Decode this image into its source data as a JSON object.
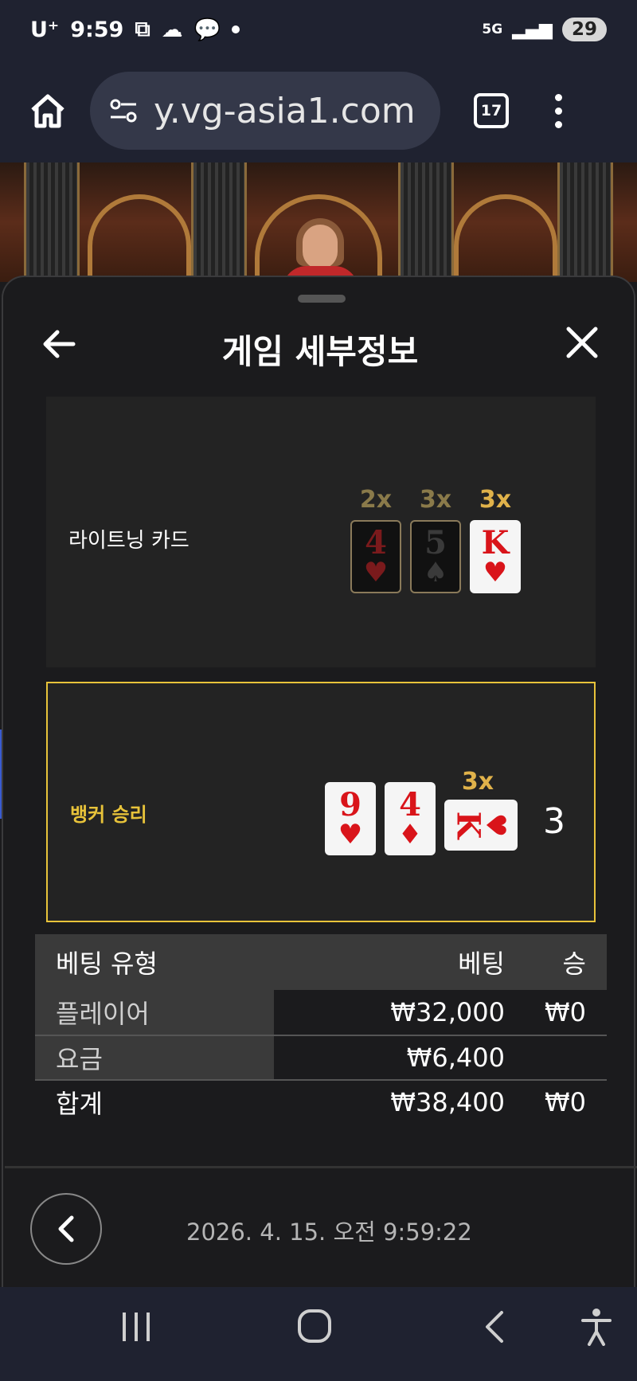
{
  "status_bar": {
    "carrier": "U⁺",
    "time": "9:59",
    "network": "5G",
    "battery": "29"
  },
  "browser": {
    "url": "y.vg-asia1.com",
    "tab_count": "17"
  },
  "sheet": {
    "title": "게임 세부정보",
    "lightning": {
      "label": "라이트닝 카드",
      "cards": [
        {
          "rank": "4",
          "suit": "♥",
          "multiplier": "2x",
          "highlight": false
        },
        {
          "rank": "5",
          "suit": "♠",
          "multiplier": "3x",
          "highlight": false
        },
        {
          "rank": "K",
          "suit": "♥",
          "multiplier": "3x",
          "highlight": true
        }
      ]
    },
    "result": {
      "label": "뱅커 승리",
      "cards": [
        {
          "rank": "9",
          "suit": "♥"
        },
        {
          "rank": "4",
          "suit": "♦"
        },
        {
          "rank": "K",
          "suit": "♥",
          "multiplier": "3x",
          "rotated": true
        }
      ],
      "score": "3"
    },
    "table": {
      "headers": [
        "베팅 유형",
        "베팅",
        "승"
      ],
      "rows": [
        {
          "type": "플레이어",
          "bet": "₩32,000",
          "win": "₩0"
        },
        {
          "type": "요금",
          "bet": "₩6,400",
          "win": ""
        }
      ],
      "total": {
        "type": "합계",
        "bet": "₩38,400",
        "win": "₩0"
      }
    },
    "timestamp": "2026. 4. 15. 오전 9:59:22"
  },
  "colors": {
    "accent_gold": "#e0b24a",
    "highlight_border": "#e8c33a",
    "card_red": "#d9141a"
  }
}
